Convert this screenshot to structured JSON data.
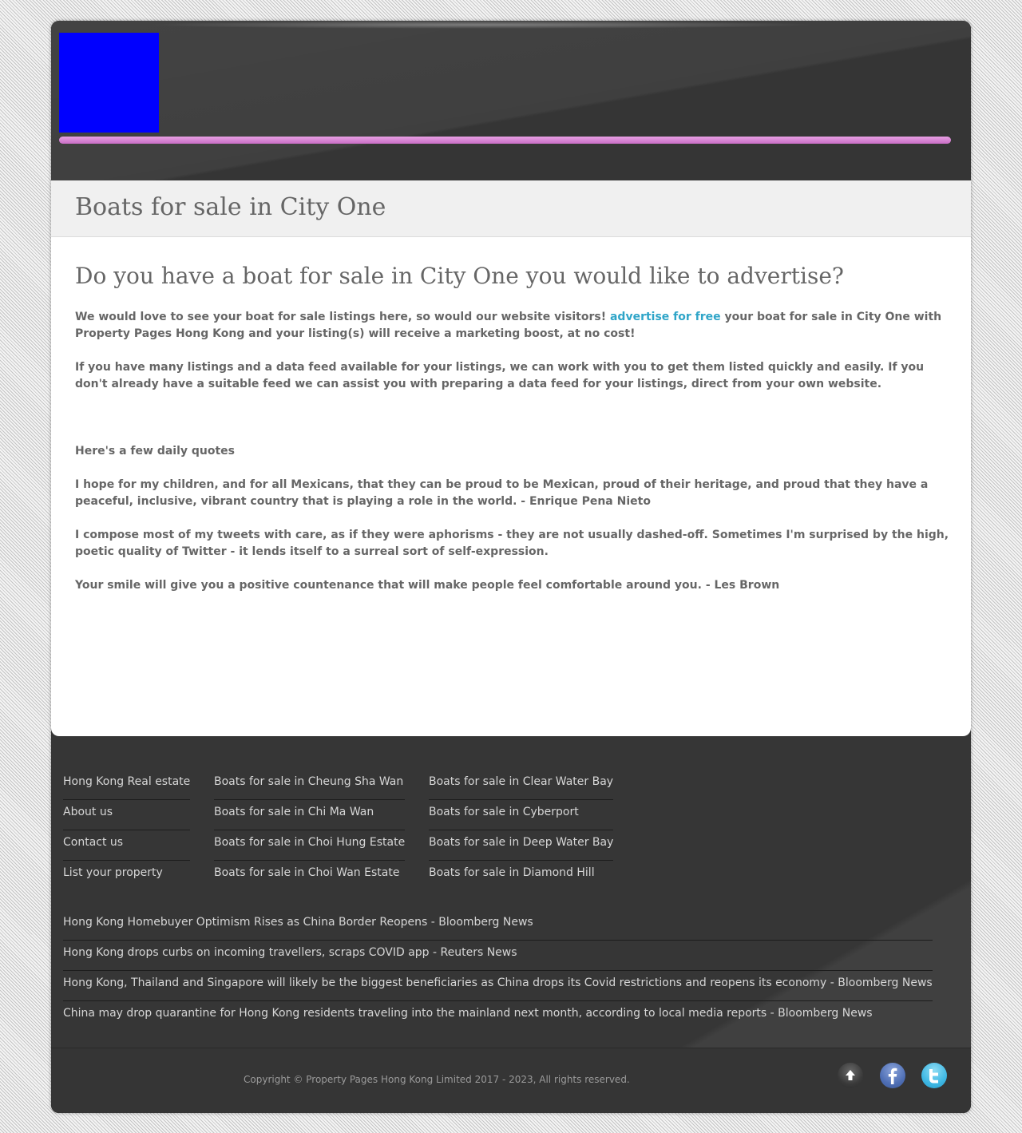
{
  "page": {
    "title": "Boats for sale in City One"
  },
  "content": {
    "heading": "Do you have a boat for sale in City One you would like to advertise?",
    "intro_before_link": "We would love to see your boat for sale listings here, so would our website visitors! ",
    "intro_link": "advertise for free",
    "intro_after_link": " your boat for sale in City One with Property Pages Hong Kong and your listing(s) will receive a marketing boost, at no cost!",
    "feed_paragraph": "If you have many listings and a data feed available for your listings, we can work with you to get them listed quickly and easily. If you don't already have a suitable feed we can assist you with preparing a data feed for your listings, direct from your own website.",
    "quotes_heading": "Here's a few daily quotes",
    "quotes": [
      "I hope for my children, and for all Mexicans, that they can be proud to be Mexican, proud of their heritage, and proud that they have a peaceful, inclusive, vibrant country that is playing a role in the world. - Enrique Pena Nieto",
      "I compose most of my tweets with care, as if they were aphorisms - they are not usually dashed-off. Sometimes I'm surprised by the high, poetic quality of Twitter - it lends itself to a surreal sort of self-expression.",
      "Your smile will give you a positive countenance that will make people feel comfortable around you. - Les Brown"
    ]
  },
  "footer": {
    "col1": [
      "Hong Kong Real estate",
      "About us",
      "Contact us",
      "List your property"
    ],
    "col2": [
      "Boats for sale in Cheung Sha Wan",
      "Boats for sale in Chi Ma Wan",
      "Boats for sale in Choi Hung Estate",
      "Boats for sale in Choi Wan Estate"
    ],
    "col3": [
      "Boats for sale in Clear Water Bay",
      "Boats for sale in Cyberport",
      "Boats for sale in Deep Water Bay",
      "Boats for sale in Diamond Hill"
    ],
    "news": [
      "Hong Kong Homebuyer Optimism Rises as China Border Reopens - Bloomberg News",
      "Hong Kong drops curbs on incoming travellers, scraps COVID app - Reuters News",
      "Hong Kong, Thailand and Singapore will likely be the biggest beneficiaries as China drops its Covid restrictions and reopens its economy - Bloomberg News",
      "China may drop quarantine for Hong Kong residents traveling into the mainland next month, according to local media reports - Bloomberg News"
    ],
    "copyright": "Copyright © Property Pages Hong Kong Limited 2017 - 2023, All rights reserved.",
    "icons": [
      "scroll-to-top-icon",
      "facebook-icon",
      "twitter-icon"
    ]
  },
  "colors": {
    "frame": "#353535",
    "accent_bar": "#d07ccc",
    "logo": "#0000ff",
    "link": "#2fa5c8",
    "text": "#666666"
  }
}
